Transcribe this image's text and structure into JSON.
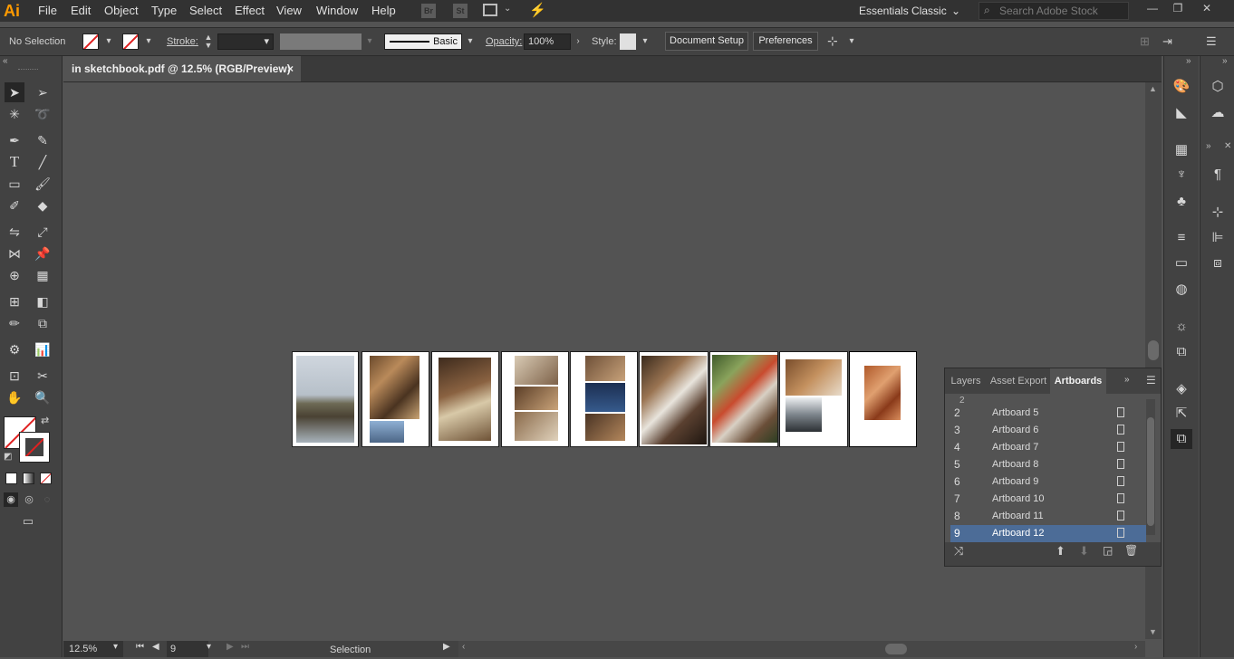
{
  "app": {
    "logo": "Ai",
    "menu": [
      "File",
      "Edit",
      "Object",
      "Type",
      "Select",
      "Effect",
      "View",
      "Window",
      "Help"
    ],
    "bridge_badge": "Br",
    "stock_badge": "St",
    "workspace": "Essentials Classic",
    "search_placeholder": "Search Adobe Stock"
  },
  "control": {
    "selection": "No Selection",
    "stroke_label": "Stroke:",
    "brush_label": "Basic",
    "opacity_label": "Opacity:",
    "opacity_value": "100%",
    "style_label": "Style:",
    "doc_setup": "Document Setup",
    "preferences": "Preferences"
  },
  "document": {
    "tab_title": "in sketchbook.pdf @ 12.5% (RGB/Preview)",
    "close": "×"
  },
  "status": {
    "zoom": "12.5%",
    "artboard_nav": "9",
    "tool": "Selection"
  },
  "artboards_panel": {
    "tabs": [
      "Layers",
      "Asset Export",
      "Artboards"
    ],
    "rows": [
      {
        "num": "2",
        "name": "Artboard 5"
      },
      {
        "num": "3",
        "name": "Artboard 6"
      },
      {
        "num": "4",
        "name": "Artboard 7"
      },
      {
        "num": "5",
        "name": "Artboard 8"
      },
      {
        "num": "6",
        "name": "Artboard 9"
      },
      {
        "num": "7",
        "name": "Artboard 10"
      },
      {
        "num": "8",
        "name": "Artboard 11"
      },
      {
        "num": "9",
        "name": "Artboard 12"
      }
    ],
    "selected_index": 7
  },
  "colors": {
    "accent_selection": "#4c6c97",
    "logo": "#ff9a00"
  }
}
